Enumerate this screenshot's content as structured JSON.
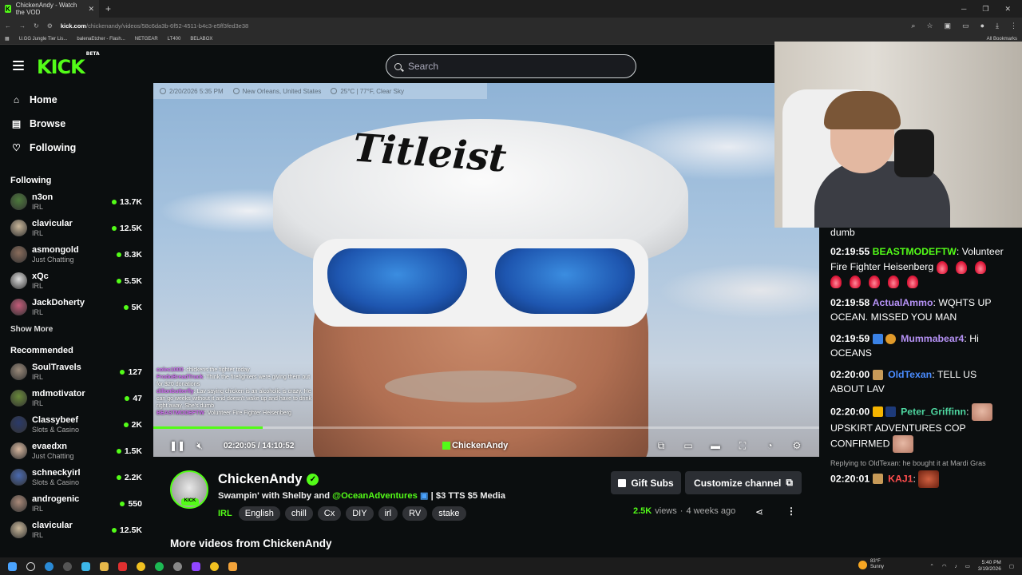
{
  "browser": {
    "tab_title": "ChickenAndy - Watch the VOD",
    "url_host": "kick.com",
    "url_path": "/chickenandy/videos/58c6da3b-6f52-4511-b4c3-e5ff3fed3e38",
    "bookmarks": [
      "U.GG Jungle Tier Lis...",
      "balenaEtcher - Flash...",
      "NETGEAR",
      "LT400",
      "BELABOX"
    ],
    "all_bookmarks": "All Bookmarks"
  },
  "header": {
    "logo": "KICK",
    "logo_badge": "BETA",
    "search_placeholder": "Search"
  },
  "sidebar": {
    "nav": [
      {
        "label": "Home",
        "icon": "home-icon"
      },
      {
        "label": "Browse",
        "icon": "browse-icon"
      },
      {
        "label": "Following",
        "icon": "heart-icon"
      }
    ],
    "following_title": "Following",
    "following": [
      {
        "name": "n3on",
        "category": "IRL",
        "viewers": "13.7K",
        "color": "#4d7a3c"
      },
      {
        "name": "clavicular",
        "category": "IRL",
        "viewers": "12.5K",
        "color": "#c9b79a"
      },
      {
        "name": "asmongold",
        "category": "Just Chatting",
        "viewers": "8.3K",
        "color": "#8a6d5c"
      },
      {
        "name": "xQc",
        "category": "IRL",
        "viewers": "5.5K",
        "color": "#dddddd"
      },
      {
        "name": "JackDoherty",
        "category": "IRL",
        "viewers": "5K",
        "color": "#c45c7a"
      }
    ],
    "show_more": "Show More",
    "recommended_title": "Recommended",
    "recommended": [
      {
        "name": "SoulTravels",
        "category": "IRL",
        "viewers": "127",
        "color": "#9a8a7a"
      },
      {
        "name": "mdmotivator",
        "category": "IRL",
        "viewers": "47",
        "color": "#6a8a3a"
      },
      {
        "name": "Classybeef",
        "category": "Slots & Casino",
        "viewers": "2K",
        "color": "#2a3a6a"
      },
      {
        "name": "evaedxn",
        "category": "Just Chatting",
        "viewers": "1.5K",
        "color": "#d8b8a0"
      },
      {
        "name": "schneckyirl",
        "category": "Slots & Casino",
        "viewers": "2.2K",
        "color": "#4a6ab0"
      },
      {
        "name": "androgenic",
        "category": "IRL",
        "viewers": "550",
        "color": "#aa8a7a"
      },
      {
        "name": "clavicular",
        "category": "IRL",
        "viewers": "12.5K",
        "color": "#c9b79a"
      }
    ]
  },
  "video": {
    "overlay_date": "2/20/2026 5:35 PM",
    "overlay_location": "New Orleans, United States",
    "overlay_weather": "25°C | 77°F, Clear Sky",
    "cap_text": "Titleist",
    "chat_overlay": [
      {
        "user": "colec1000",
        "text": "chickens the fighter today"
      },
      {
        "user": "FrodoBreadTruck",
        "text": "Think the firefighters were giving them out for $20 donations"
      },
      {
        "user": "dillonbutterfly",
        "text": "Lav saying chicken is an alcoholic is crazy. He can go weeks without it and doesn't wake up and have to drink right away. She's dumb"
      },
      {
        "user": "BEASTMODEFTW",
        "text": "Volunteer Fire Fighter Heisenberg"
      }
    ],
    "current_time": "02:20:05",
    "duration": "14:10:52",
    "progress": 0.164,
    "watermark": "ChickenAndy"
  },
  "chat": {
    "partial_top": "dumb",
    "messages": [
      {
        "time": "02:19:55",
        "user": "BEASTMODEFTW",
        "user_color": "green",
        "text": "Volunteer Fire Fighter Heisenberg",
        "emotes": 8
      },
      {
        "time": "02:19:58",
        "user": "ActualAmmo",
        "user_color": "purple",
        "text": "WQHTS UP OCEAN. MISSED YOU MAN"
      },
      {
        "time": "02:19:59",
        "user": "Mummabear4",
        "user_color": "purple",
        "text": "Hi OCEANS"
      },
      {
        "time": "02:20:00",
        "user": "OldTexan",
        "user_color": "blue",
        "text": "TELL US ABOUT LAV"
      },
      {
        "time": "02:20:00",
        "user": "Peter_Griffinn",
        "user_color": "teal",
        "text": "UPSKIRT ADVENTURES COP CONFIRMED"
      },
      {
        "reply_to": "Replying to OldTexan: he bought it at Mardi Gras",
        "time": "02:20:01",
        "user": "KAJ1",
        "user_color": "red",
        "text": ""
      }
    ]
  },
  "stream": {
    "channel_name": "ChickenAndy",
    "title_pre": "Swampin' with Shelby and",
    "title_mention": "@OceanAdventures",
    "title_post": "| $3 TTS $5 Media",
    "category": "IRL",
    "tags": [
      "English",
      "chill",
      "Cx",
      "DIY",
      "irl",
      "RV",
      "stake"
    ],
    "gift_label": "Gift Subs",
    "customize_label": "Customize channel",
    "views": "2.5K",
    "views_label": "views",
    "separator": "·",
    "age": "4 weeks ago",
    "more_videos": "More videos from ChickenAndy"
  },
  "taskbar": {
    "weather_temp": "83°F",
    "weather_desc": "Sunny",
    "time": "5:40 PM",
    "date": "3/19/2026"
  }
}
